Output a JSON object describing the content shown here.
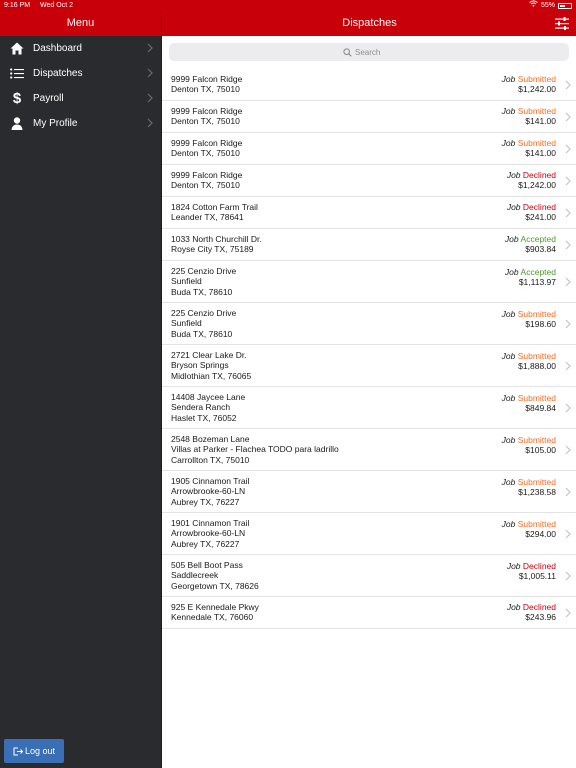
{
  "status_bar": {
    "time": "9:16 PM",
    "date": "Wed Oct 2",
    "battery": "55%"
  },
  "sidebar": {
    "title": "Menu",
    "items": [
      {
        "label": "Dashboard",
        "icon": "home-icon"
      },
      {
        "label": "Dispatches",
        "icon": "list-icon"
      },
      {
        "label": "Payroll",
        "icon": "dollar-icon"
      },
      {
        "label": "My Profile",
        "icon": "person-icon"
      }
    ],
    "logout_label": "Log out"
  },
  "main": {
    "title": "Dispatches",
    "search_placeholder": "Search",
    "job_word": "Job",
    "dispatches": [
      {
        "lines": [
          "9999 Falcon Ridge",
          "Denton TX, 75010"
        ],
        "status": "Submitted",
        "amount": "$1,242.00"
      },
      {
        "lines": [
          "9999 Falcon Ridge",
          "Denton TX, 75010"
        ],
        "status": "Submitted",
        "amount": "$141.00"
      },
      {
        "lines": [
          "9999 Falcon Ridge",
          "Denton TX, 75010"
        ],
        "status": "Submitted",
        "amount": "$141.00"
      },
      {
        "lines": [
          "9999 Falcon Ridge",
          "Denton TX, 75010"
        ],
        "status": "Declined",
        "amount": "$1,242.00"
      },
      {
        "lines": [
          "1824 Cotton Farm Trail",
          "Leander TX, 78641"
        ],
        "status": "Declined",
        "amount": "$241.00"
      },
      {
        "lines": [
          "1033 North Churchill Dr.",
          "Royse City TX, 75189"
        ],
        "status": "Accepted",
        "amount": "$903.84"
      },
      {
        "lines": [
          "225 Cenzio Drive",
          "Sunfield",
          "Buda TX, 78610"
        ],
        "status": "Accepted",
        "amount": "$1,113.97"
      },
      {
        "lines": [
          "225 Cenzio Drive",
          "Sunfield",
          "Buda TX, 78610"
        ],
        "status": "Submitted",
        "amount": "$198.60"
      },
      {
        "lines": [
          "2721 Clear Lake Dr.",
          "Bryson Springs",
          "Midlothian TX, 76065"
        ],
        "status": "Submitted",
        "amount": "$1,888.00"
      },
      {
        "lines": [
          "14408 Jaycee Lane",
          "Sendera Ranch",
          "Haslet TX, 76052"
        ],
        "status": "Submitted",
        "amount": "$849.84"
      },
      {
        "lines": [
          "2548 Bozeman Lane",
          "Villas at Parker - Flachea TODO para ladrillo",
          "Carrollton TX, 75010"
        ],
        "status": "Submitted",
        "amount": "$105.00"
      },
      {
        "lines": [
          "1905 Cinnamon Trail",
          "Arrowbrooke-60-LN",
          "Aubrey TX, 76227"
        ],
        "status": "Submitted",
        "amount": "$1,238.58"
      },
      {
        "lines": [
          "1901 Cinnamon Trail",
          "Arrowbrooke-60-LN",
          "Aubrey TX, 76227"
        ],
        "status": "Submitted",
        "amount": "$294.00"
      },
      {
        "lines": [
          "505 Bell Boot Pass",
          "Saddlecreek",
          "Georgetown TX, 78626"
        ],
        "status": "Declined",
        "amount": "$1,005.11"
      },
      {
        "lines": [
          "925 E Kennedale Pkwy",
          "Kennedale TX, 76060"
        ],
        "status": "Declined",
        "amount": "$243.96"
      }
    ]
  },
  "colors": {
    "header_red": "#c8000a",
    "sidebar_bg": "#2a2b2f",
    "submitted": "#f26d24",
    "declined": "#c8000a",
    "accepted": "#4a9b2a",
    "logout_blue": "#3a6fb5"
  }
}
